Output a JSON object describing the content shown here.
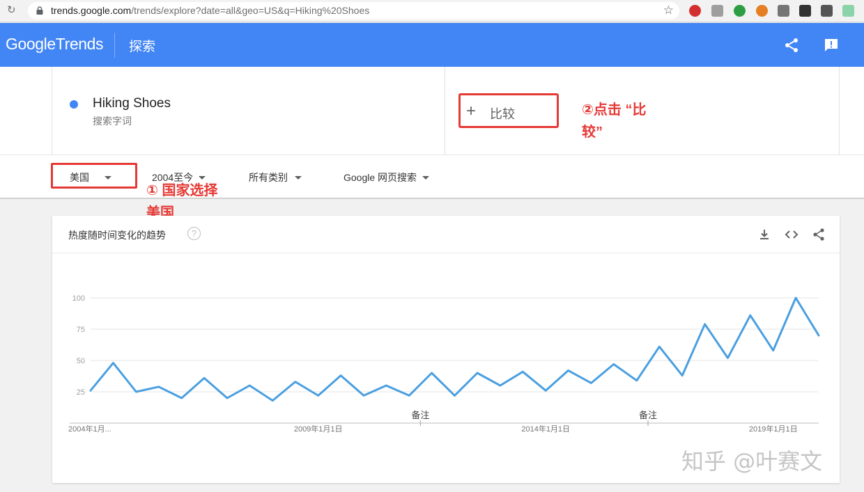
{
  "browser": {
    "url_host": "trends.google.com",
    "url_path": "/trends/explore?date=all&geo=US&q=Hiking%20Shoes"
  },
  "header": {
    "logo_google": "Google",
    "logo_trends": "Trends",
    "page_title": "探索"
  },
  "term": {
    "name": "Hiking Shoes",
    "subtitle": "搜索字词",
    "color": "#4285f4"
  },
  "compare": {
    "plus": "+",
    "label": "比较"
  },
  "annotations": {
    "compare_line1": "②点击 “比",
    "compare_line2": "较”",
    "country_line1": "① 国家选择",
    "country_line2": "美国",
    "color": "#e53935"
  },
  "filters": {
    "country": "美国",
    "time_range": "2004至今",
    "category": "所有类别",
    "search_type": "Google 网页搜索"
  },
  "chart_card": {
    "title": "热度随时间变化的趋势",
    "help": "?"
  },
  "watermark": "知乎 @叶赛文",
  "chart_data": {
    "type": "line",
    "y_ticks": [
      "100",
      "75",
      "50",
      "25"
    ],
    "ylim": [
      0,
      100
    ],
    "x_tick_labels": [
      "2004年1月...",
      "2009年1月1日",
      "2014年1月1日",
      "2019年1月1日"
    ],
    "notes": [
      "备注",
      "备注"
    ],
    "grid": true,
    "series": [
      {
        "name": "Hiking Shoes",
        "color": "#4a9fe0",
        "x": [
          "2004-01",
          "2004-07",
          "2005-01",
          "2005-07",
          "2006-01",
          "2006-07",
          "2007-01",
          "2007-07",
          "2008-01",
          "2008-07",
          "2009-01",
          "2009-07",
          "2010-01",
          "2010-07",
          "2011-01",
          "2011-07",
          "2012-01",
          "2012-07",
          "2013-01",
          "2013-07",
          "2014-01",
          "2014-07",
          "2015-01",
          "2015-07",
          "2016-01",
          "2016-07",
          "2017-01",
          "2017-07",
          "2018-01",
          "2018-07",
          "2019-01",
          "2019-07",
          "2020-01"
        ],
        "values": [
          26,
          48,
          25,
          29,
          20,
          36,
          20,
          30,
          18,
          33,
          22,
          38,
          22,
          30,
          22,
          40,
          22,
          40,
          30,
          41,
          26,
          42,
          32,
          47,
          34,
          61,
          38,
          79,
          52,
          86,
          58,
          100,
          70
        ]
      }
    ]
  }
}
